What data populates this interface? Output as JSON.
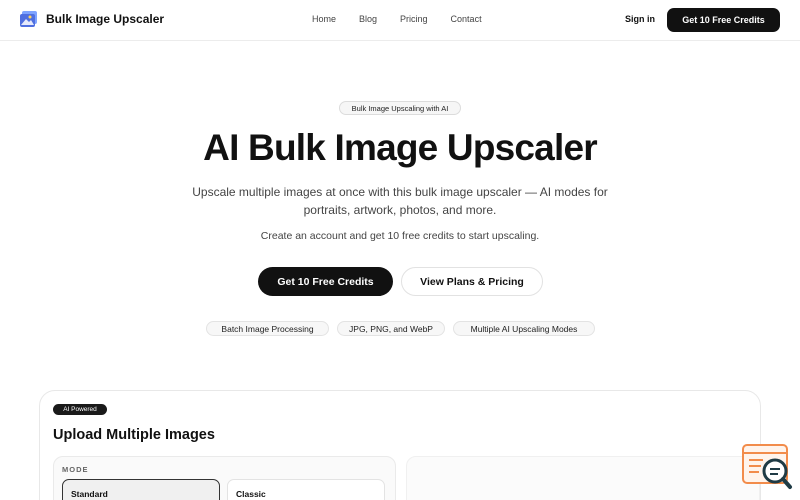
{
  "header": {
    "brand": "Bulk Image Upscaler",
    "nav": [
      "Home",
      "Blog",
      "Pricing",
      "Contact"
    ],
    "signin": "Sign in",
    "cta": "Get 10 Free Credits"
  },
  "hero": {
    "badge": "Bulk Image Upscaling with AI",
    "title": "AI Bulk Image Upscaler",
    "subtitle": "Upscale multiple images at once with this bulk image upscaler — AI modes for portraits, artwork, photos, and more.",
    "note": "Create an account and get 10 free credits to start upscaling.",
    "primary_button": "Get 10 Free Credits",
    "secondary_button": "View Plans & Pricing",
    "features": [
      "Batch Image Processing",
      "JPG, PNG, and WebP",
      "Multiple AI Upscaling Modes"
    ]
  },
  "upload_card": {
    "badge": "AI Powered",
    "title": "Upload Multiple Images",
    "mode_label": "MODE",
    "modes": [
      "Standard",
      "Classic"
    ],
    "selected_mode": "Standard"
  },
  "colors": {
    "primary": "#111111",
    "text_muted": "#444444",
    "border": "#e8e8e8",
    "widget_orange": "#f28c4b",
    "widget_teal": "#1f3b45"
  },
  "icons": {
    "logo": "image-stack-icon",
    "widget": "search-chat-icon"
  }
}
